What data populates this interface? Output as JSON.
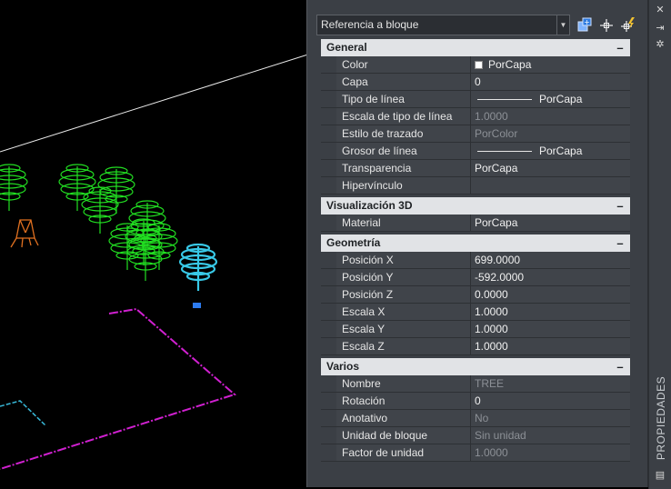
{
  "selection": {
    "value": "Referencia a bloque"
  },
  "toolbar": {
    "icons": [
      "toggle-pickadd-icon",
      "select-objects-icon",
      "quick-select-icon"
    ]
  },
  "sections": [
    {
      "title": "General",
      "toggle": "–",
      "rows": [
        {
          "label": "Color",
          "value": "PorCapa",
          "kind": "swatch",
          "readonly": false
        },
        {
          "label": "Capa",
          "value": "0",
          "readonly": false
        },
        {
          "label": "Tipo de línea",
          "value": "PorCapa",
          "kind": "line",
          "readonly": false
        },
        {
          "label": "Escala de tipo de línea",
          "value": "1.0000",
          "readonly": true
        },
        {
          "label": "Estilo de trazado",
          "value": "PorColor",
          "readonly": true
        },
        {
          "label": "Grosor de línea",
          "value": "PorCapa",
          "kind": "line",
          "readonly": false
        },
        {
          "label": "Transparencia",
          "value": "PorCapa",
          "readonly": false
        },
        {
          "label": "Hipervínculo",
          "value": "",
          "readonly": false
        }
      ]
    },
    {
      "title": "Visualización 3D",
      "toggle": "–",
      "rows": [
        {
          "label": "Material",
          "value": "PorCapa",
          "readonly": false
        }
      ]
    },
    {
      "title": "Geometría",
      "toggle": "–",
      "rows": [
        {
          "label": "Posición X",
          "value": "699.0000",
          "readonly": false
        },
        {
          "label": "Posición Y",
          "value": "-592.0000",
          "readonly": false
        },
        {
          "label": "Posición Z",
          "value": "0.0000",
          "readonly": false
        },
        {
          "label": "Escala X",
          "value": "1.0000",
          "readonly": false
        },
        {
          "label": "Escala Y",
          "value": "1.0000",
          "readonly": false
        },
        {
          "label": "Escala Z",
          "value": "1.0000",
          "readonly": false
        }
      ]
    },
    {
      "title": "Varios",
      "toggle": "–",
      "rows": [
        {
          "label": "Nombre",
          "value": "TREE",
          "readonly": true
        },
        {
          "label": "Rotación",
          "value": "0",
          "readonly": false
        },
        {
          "label": "Anotativo",
          "value": "No",
          "readonly": true
        },
        {
          "label": "Unidad de bloque",
          "value": "Sin unidad",
          "readonly": true
        },
        {
          "label": "Factor de unidad",
          "value": "1.0000",
          "readonly": true
        }
      ]
    }
  ],
  "palette": {
    "title": "PROPIEDADES",
    "close": "✕",
    "autohide": "⇥",
    "settings": "✲",
    "menu": "▤"
  },
  "colors": {
    "tree_green": "#22e022",
    "tree_selected": "#38c8e6",
    "boundary_magenta": "#d020d0",
    "chair_orange": "#e07020"
  }
}
